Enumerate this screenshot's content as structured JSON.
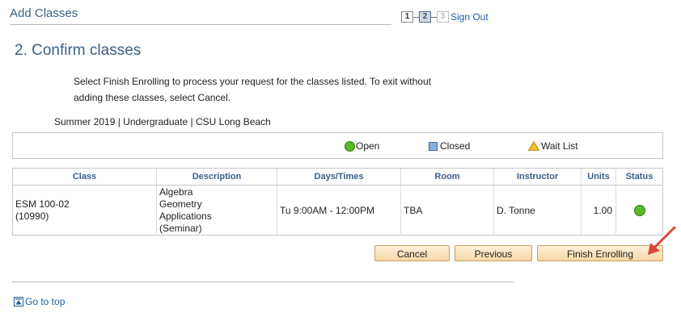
{
  "header": {
    "title": "Add Classes",
    "steps": [
      "1",
      "2",
      "3"
    ],
    "current_step": 2,
    "sign_out": "Sign Out"
  },
  "page": {
    "heading": "2.  Confirm classes",
    "instructions": "Select Finish Enrolling to process your request for the classes listed. To exit without adding these classes, select Cancel.",
    "term": "Summer 2019 | Undergraduate | CSU Long Beach"
  },
  "legend": {
    "open": "Open",
    "closed": "Closed",
    "wait_list": "Wait List"
  },
  "table": {
    "columns": [
      "Class",
      "Description",
      "Days/Times",
      "Room",
      "Instructor",
      "Units",
      "Status"
    ],
    "rows": [
      {
        "class_line1": "ESM 100-02",
        "class_line2": "(10990)",
        "description": [
          "Algebra",
          "Geometry",
          "Applications",
          "(Seminar)"
        ],
        "days_times": "Tu 9:00AM - 12:00PM",
        "room": "TBA",
        "instructor": "D. Tonne",
        "units": "1.00",
        "status": "open"
      }
    ]
  },
  "buttons": {
    "cancel": "Cancel",
    "previous": "Previous",
    "finish": "Finish Enrolling"
  },
  "footer": {
    "go_to_top": "Go to top"
  },
  "colors": {
    "heading": "#3a5f85",
    "link": "#1f5ca8",
    "open_green": "#5cb82b",
    "closed_blue": "#8ab0dd",
    "wait_yellow": "#f5c422",
    "arrow_red": "#e0453a",
    "button_bg": "#f6d8a6"
  }
}
